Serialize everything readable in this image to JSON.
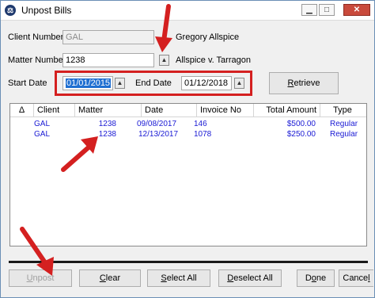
{
  "window": {
    "title": "Unpost Bills",
    "app_icon": "law-app-icon",
    "minimize": "▁",
    "maximize": "□",
    "close": "✕"
  },
  "form": {
    "client_number_label": "Client Number",
    "client_number_value": "GAL",
    "client_name": "Gregory Allspice",
    "matter_number_label": "Matter Number",
    "matter_number_value": "1238",
    "matter_name": "Allspice v. Tarragon",
    "start_date_label": "Start Date",
    "start_date_value": "01/01/2015",
    "end_date_label": "End Date",
    "end_date_value": "01/12/2018",
    "retrieve_label": "Retrieve",
    "retrieve_mnemonic": "R",
    "retrieve_rest": "etrieve"
  },
  "table": {
    "sort_indicator": "Δ",
    "columns": [
      "Client",
      "Matter",
      "Date",
      "Invoice No",
      "Total Amount",
      "Type"
    ],
    "rows": [
      {
        "client": "GAL",
        "matter": "1238",
        "date": "09/08/2017",
        "invoice": "146",
        "amount": "$500.00",
        "type": "Regular"
      },
      {
        "client": "GAL",
        "matter": "1238",
        "date": "12/13/2017",
        "invoice": "1078",
        "amount": "$250.00",
        "type": "Regular"
      }
    ]
  },
  "buttons": {
    "unpost": {
      "mnemonic": "U",
      "rest": "npost"
    },
    "clear": {
      "mnemonic": "C",
      "rest": "lear"
    },
    "select_all": {
      "mnemonic": "S",
      "rest": "elect All"
    },
    "deselect_all": {
      "mnemonic": "D",
      "rest": "eselect All"
    },
    "done": {
      "pre": "D",
      "mnemonic": "o",
      "rest": "ne"
    },
    "cancel": {
      "pre": "Cance",
      "mnemonic": "l",
      "rest": ""
    }
  },
  "colors": {
    "annotation_red": "#d42020",
    "row_text": "#1a1ad4",
    "focus_highlight": "#1f6fd1"
  }
}
